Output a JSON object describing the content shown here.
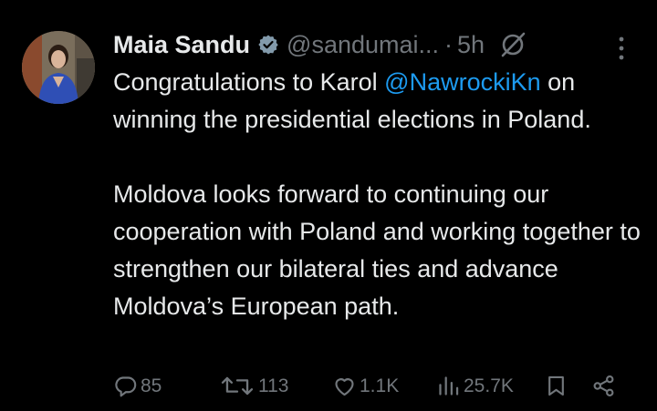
{
  "tweet": {
    "author_name": "Maia Sandu",
    "author_handle": "@sandumai...",
    "separator": "·",
    "time": "5h",
    "text_before_mention": "Congratulations to Karol ",
    "mention": "@NawrockiKn",
    "text_after_mention": " on winning the presidential elections in Poland.",
    "paragraph2": "Moldova looks forward to continuing our cooperation with Poland and working together to strengthen our bilateral ties and advance Moldova’s European path."
  },
  "actions": {
    "replies": "85",
    "reposts": "113",
    "likes": "1.1K",
    "views": "25.7K"
  },
  "colors": {
    "background": "#000000",
    "text": "#e7e9ea",
    "secondary": "#71767b",
    "accent": "#1d9bf0"
  },
  "icons": [
    "verified-badge-icon",
    "grok-icon",
    "more-icon",
    "reply-icon",
    "repost-icon",
    "like-icon",
    "views-icon",
    "bookmark-icon",
    "share-icon"
  ]
}
